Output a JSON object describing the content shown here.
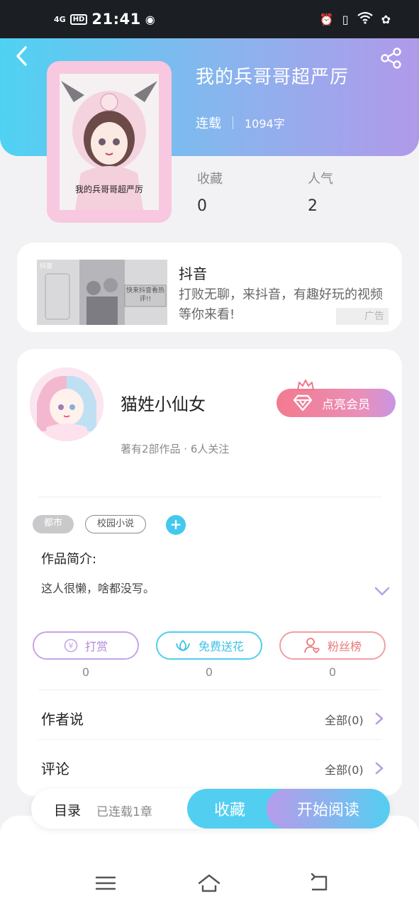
{
  "status_bar": {
    "signal": "4G",
    "hd": "HD",
    "time": "21:41",
    "icons": [
      "alarm-icon",
      "vibrate-icon",
      "wifi-icon",
      "flower-icon"
    ]
  },
  "book": {
    "title": "我的兵哥哥超严厉",
    "status": "连载",
    "word_count": "1094字",
    "cover_text": "我的兵哥哥超严厉",
    "stats": [
      {
        "label": "收藏",
        "value": "0"
      },
      {
        "label": "人气",
        "value": "2"
      }
    ]
  },
  "ad": {
    "title": "抖音",
    "desc": "打败无聊，来抖音，有趣好玩的视频等你来看!",
    "badge": "广告",
    "image_text_brand": "抖音",
    "image_text_promo": "快来抖音看热评!!"
  },
  "author": {
    "name": "猫姓小仙女",
    "info": "著有2部作品 · 6人关注",
    "vip_label": "点亮会员"
  },
  "tags": [
    "都市",
    "校园小说"
  ],
  "intro": {
    "label": "作品简介:",
    "text": "这人很懒，啥都没写。"
  },
  "actions": [
    {
      "label": "打赏",
      "count": "0"
    },
    {
      "label": "免费送花",
      "count": "0"
    },
    {
      "label": "粉丝榜",
      "count": "0"
    }
  ],
  "rows": [
    {
      "title": "作者说",
      "more": "全部(0)"
    },
    {
      "title": "评论",
      "more": "全部(0)"
    }
  ],
  "bottom_bar": {
    "toc": "目录",
    "status": "已连载1章",
    "collect": "收藏",
    "read": "开始阅读"
  },
  "colors": {
    "header_start": "#4fd2f2",
    "header_end": "#b199ea",
    "accent_blue": "#52cff0",
    "vip_pink": "#f37a8e"
  }
}
